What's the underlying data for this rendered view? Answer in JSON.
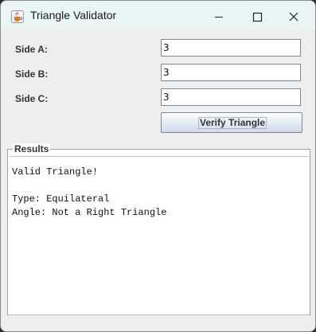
{
  "window": {
    "title": "Triangle Validator",
    "icon": "java-cup-icon"
  },
  "titlebar_controls": {
    "minimize": "minimize-icon",
    "maximize": "maximize-icon",
    "close": "close-icon"
  },
  "form": {
    "fields": [
      {
        "label": "Side A:",
        "value": "3"
      },
      {
        "label": "Side B:",
        "value": "3"
      },
      {
        "label": "Side C:",
        "value": "3"
      }
    ],
    "verify_button": "Verify Triangle"
  },
  "results": {
    "title": "Results",
    "lines": [
      "Valid Triangle!",
      "",
      "Type: Equilateral",
      "Angle: Not a Right Triangle"
    ]
  },
  "colors": {
    "titlebar_bg": "#e9f6f5",
    "window_bg": "#eeeeee",
    "field_border": "#7a8a99"
  }
}
